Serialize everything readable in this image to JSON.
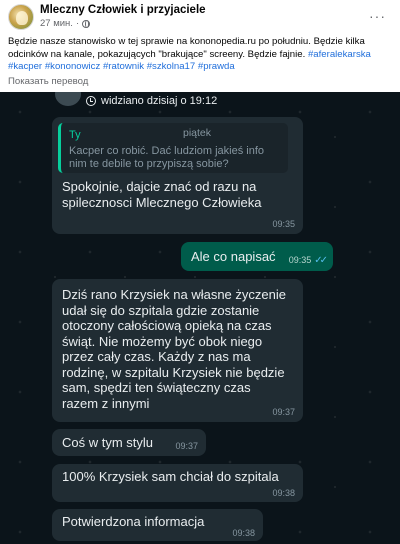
{
  "post": {
    "page_name": "Mleczny Człowiek i przyjaciele",
    "time": "27 мин.",
    "separator": "·",
    "more_label": "···",
    "text_main": "Będzie nasze stanowisko w tej sprawie na kononopedia.ru po południu. Będzie kilka odcinków na kanale, pokazujących \"brakujące\" screeny. Będzie fajnie.",
    "hashtags": [
      "#aferalekarska",
      "#kacper",
      "#kononowicz",
      "#ratownik",
      "#szkolna17",
      "#prawda"
    ],
    "translate_label": "Показать перевод"
  },
  "chat": {
    "status": "widziano dzisiaj o 19:12",
    "messages": [
      {
        "id": "m1",
        "direction": "in",
        "quote_author": "Ty",
        "quote_day": "piątek",
        "quote_text": "Kacper co robić. Dać ludziom jakieś info nim te debile to przypiszą sobie?",
        "text": "Spokojnie, dajcie znać od razu na spilecznosci Mlecznego Człowieka",
        "time": "09:35"
      },
      {
        "id": "m2",
        "direction": "out",
        "text": "Ale co napisać",
        "time": "09:35",
        "read": true
      },
      {
        "id": "m3",
        "direction": "in",
        "text": "Dziś rano Krzysiek na własne życzenie udał się do szpitala gdzie zostanie otoczony całościową opieką na czas świąt. Nie możemy być obok niego przez cały czas. Każdy z nas ma rodzinę, w szpitalu Krzysiek nie będzie sam, spędzi ten świąteczny czas razem z innymi",
        "time": "09:37"
      },
      {
        "id": "m4",
        "direction": "in",
        "text": "Coś w tym stylu",
        "time": "09:37"
      },
      {
        "id": "m5",
        "direction": "in",
        "text": "100% Krzysiek sam chciał do szpitala",
        "time": "09:38"
      },
      {
        "id": "m6",
        "direction": "in",
        "text": "Potwierdzona informacja",
        "time": "09:38"
      }
    ]
  },
  "colors": {
    "hashtag": "#216fdb",
    "chat_bg": "#0b141a",
    "bubble_in": "#202c33",
    "bubble_out": "#005c4b",
    "quote_accent": "#06cf9c",
    "read_ticks": "#53bdeb"
  },
  "icons": {
    "status": "status-seen-icon",
    "privacy": "globe-icon",
    "read": "double-check-icon"
  }
}
